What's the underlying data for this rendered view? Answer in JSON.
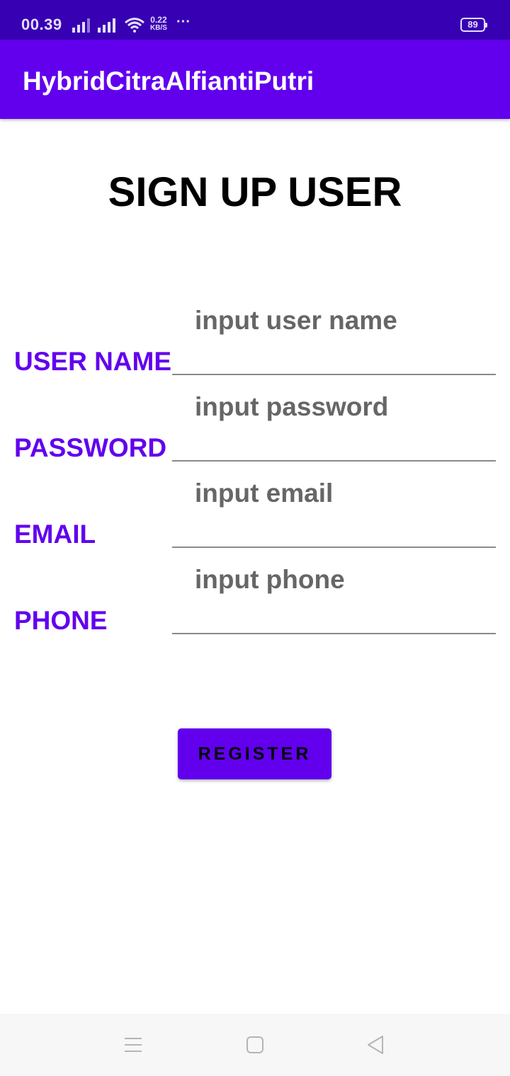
{
  "status_bar": {
    "time": "00.39",
    "net_speed_value": "0.22",
    "net_speed_unit": "KB/S",
    "more": "···",
    "battery": "89",
    "icons": [
      "signal-icon",
      "signal-icon",
      "wifi-icon",
      "battery-icon"
    ]
  },
  "app_bar": {
    "title": "HybridCitraAlfiantiPutri"
  },
  "page": {
    "heading": "SIGN UP USER"
  },
  "form": {
    "fields": [
      {
        "label": "USER NAME",
        "placeholder": "input user name",
        "value": ""
      },
      {
        "label": "PASSWORD",
        "placeholder": "input password",
        "value": ""
      },
      {
        "label": "EMAIL",
        "placeholder": "input email",
        "value": ""
      },
      {
        "label": "PHONE",
        "placeholder": "input phone",
        "value": ""
      }
    ],
    "submit_label": "REGISTER"
  },
  "nav_bar": {
    "icons": [
      "menu-icon",
      "home-icon",
      "back-icon"
    ]
  },
  "colors": {
    "status_bar": "#3700b3",
    "primary": "#6200ee",
    "label": "#6200ee",
    "placeholder": "#666666",
    "underline": "#8a8a8a",
    "nav_bar": "#f7f7f7"
  }
}
